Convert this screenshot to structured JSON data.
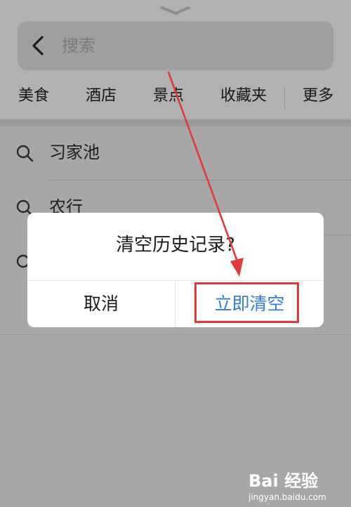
{
  "search": {
    "placeholder": "搜索"
  },
  "categories": [
    "美食",
    "酒店",
    "景点",
    "收藏夹",
    "更多"
  ],
  "history": [
    {
      "text": "习家池"
    },
    {
      "text": "农行"
    }
  ],
  "dialog": {
    "message": "清空历史记录?",
    "cancel_label": "取消",
    "confirm_label": "立即清空"
  },
  "watermark": {
    "brand": "Bai 经验",
    "url": "jingyan.baidu.com"
  },
  "colors": {
    "confirm": "#2f7bd5",
    "annotation": "#e03a3a",
    "overlay": "#a7a7a7"
  },
  "icons": [
    "chevron-down-icon",
    "back-icon",
    "search-icon"
  ]
}
